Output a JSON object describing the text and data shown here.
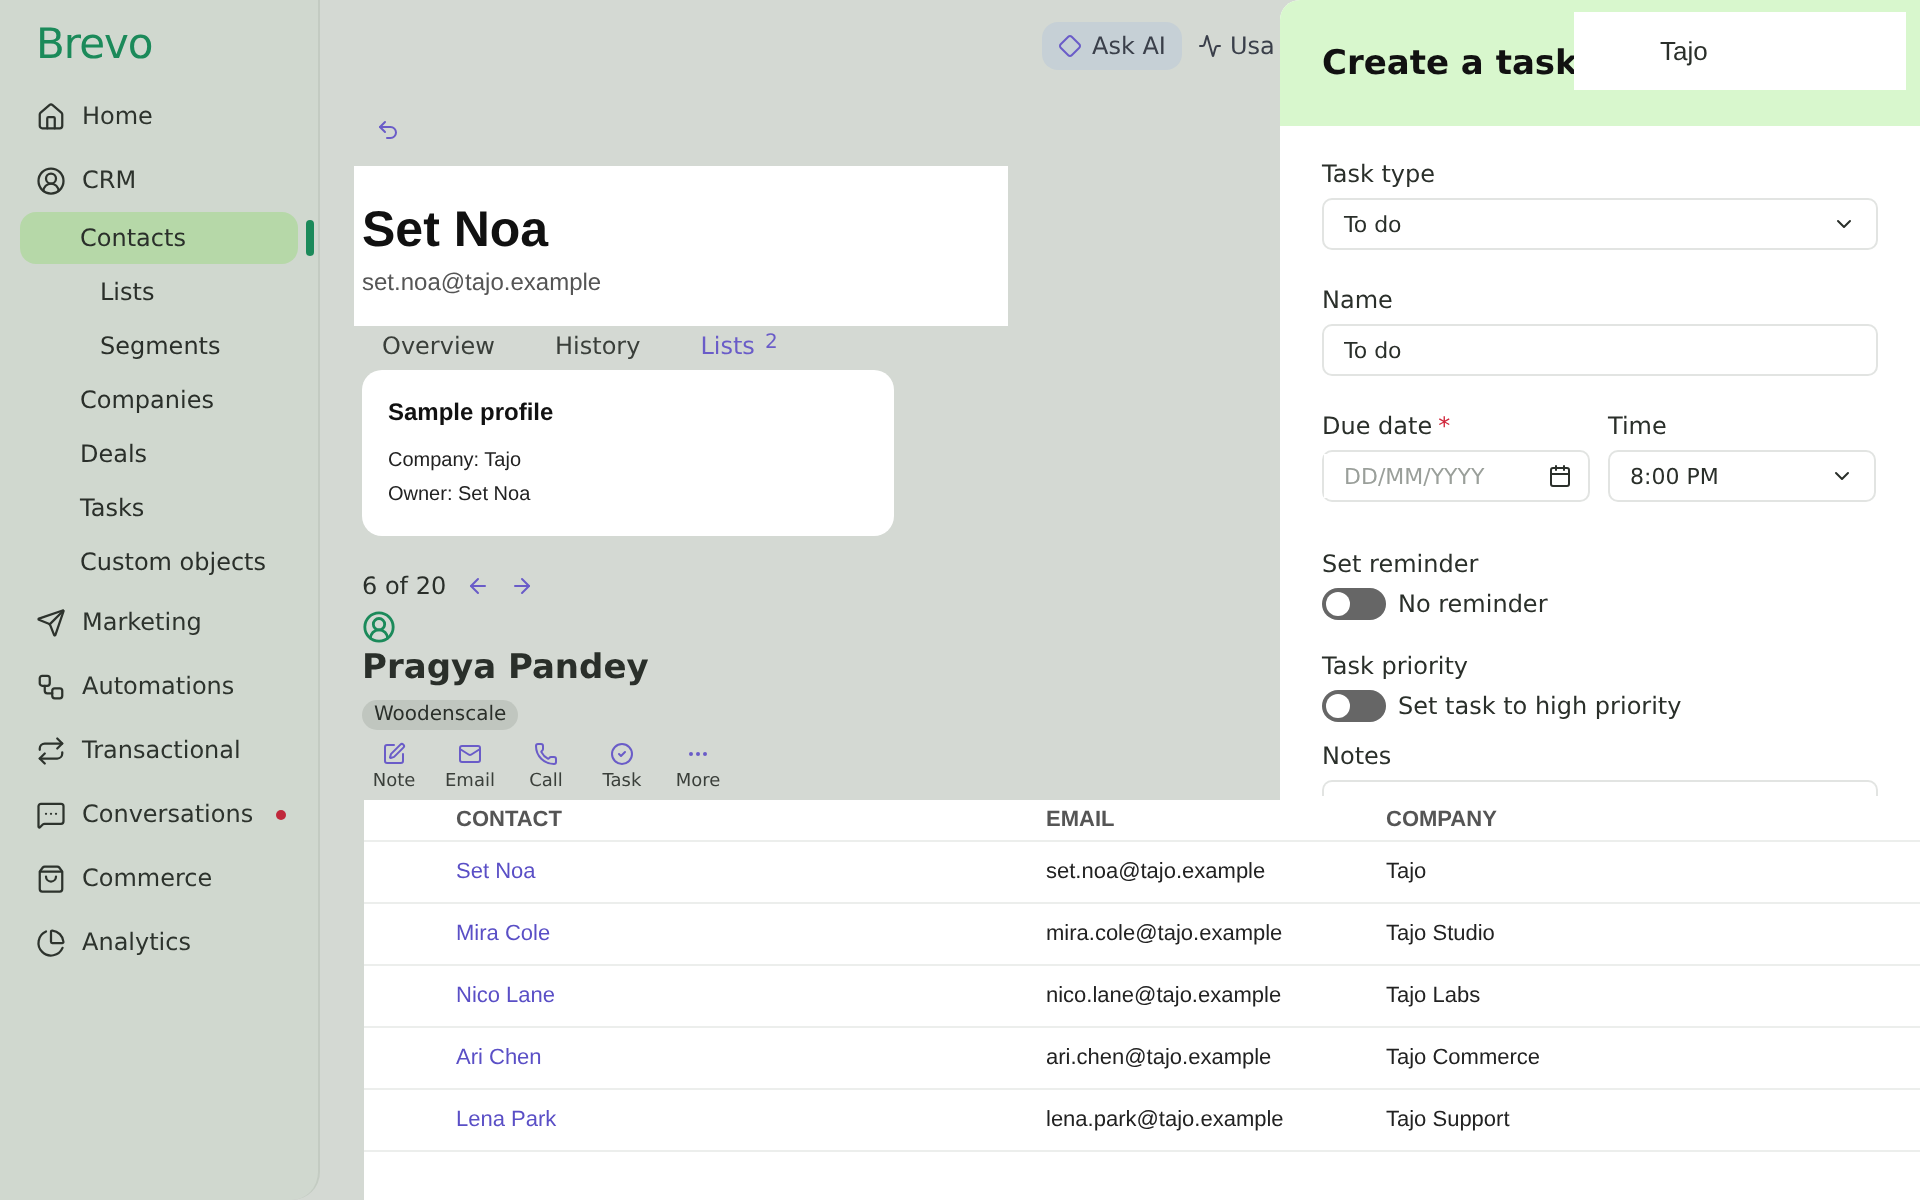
{
  "brand": "Brevo",
  "sidebar": {
    "items": [
      {
        "label": "Home",
        "selected": false
      },
      {
        "label": "CRM",
        "selected": false,
        "children": [
          {
            "label": "Contacts",
            "selected": true,
            "children": [
              {
                "label": "Lists",
                "selected": false
              },
              {
                "label": "Segments",
                "selected": false
              }
            ]
          },
          {
            "label": "Companies",
            "selected": false
          },
          {
            "label": "Deals",
            "selected": false
          },
          {
            "label": "Tasks",
            "selected": false
          },
          {
            "label": "Custom objects",
            "selected": false
          }
        ]
      },
      {
        "label": "Marketing",
        "selected": false
      },
      {
        "label": "Automations",
        "selected": false
      },
      {
        "label": "Transactional",
        "selected": false
      },
      {
        "label": "Conversations",
        "selected": false,
        "notification": true
      },
      {
        "label": "Commerce",
        "selected": false
      },
      {
        "label": "Analytics",
        "selected": false
      }
    ]
  },
  "topbar": [
    {
      "label": "Ask AI",
      "kind": "ai"
    },
    {
      "label": "Usa",
      "kind": "usage"
    }
  ],
  "contact_card": {
    "name": "Set Noa",
    "email": "set.noa@tajo.example"
  },
  "tabs": [
    {
      "label": "Overview",
      "selected": false
    },
    {
      "label": "History",
      "selected": false
    },
    {
      "label": "Lists",
      "count": "2",
      "selected": true
    }
  ],
  "profile": {
    "title": "Sample profile",
    "lines": [
      "Company: Tajo",
      "Owner: Set Noa"
    ]
  },
  "pager": "6 of 20",
  "person": {
    "name": "Pragya Pandey",
    "tag": "Woodenscale"
  },
  "actions": [
    "Note",
    "Email",
    "Call",
    "Task",
    "More"
  ],
  "drawer": {
    "title": "Create a task",
    "company": "Tajo",
    "task_type": {
      "label": "Task type",
      "value": "To do"
    },
    "name": {
      "label": "Name",
      "value": "To do"
    },
    "due_date": {
      "label": "Due date",
      "required_mark": "*",
      "placeholder": "DD/MM/YYYY"
    },
    "time": {
      "label": "Time",
      "value": "8:00 PM"
    },
    "reminder": {
      "label": "Set reminder",
      "text": "No reminder",
      "on": false
    },
    "priority": {
      "label": "Task priority",
      "text": "Set task to high priority",
      "on": false
    },
    "notes": {
      "label": "Notes"
    }
  },
  "table": {
    "columns": [
      "CONTACT",
      "EMAIL",
      "COMPANY"
    ],
    "rows": [
      [
        "Set Noa",
        "set.noa@tajo.example",
        "Tajo"
      ],
      [
        "Mira Cole",
        "mira.cole@tajo.example",
        "Tajo Studio"
      ],
      [
        "Nico Lane",
        "nico.lane@tajo.example",
        "Tajo Labs"
      ],
      [
        "Ari Chen",
        "ari.chen@tajo.example",
        "Tajo Commerce"
      ],
      [
        "Lena Park",
        "lena.park@tajo.example",
        "Tajo Support"
      ]
    ]
  }
}
